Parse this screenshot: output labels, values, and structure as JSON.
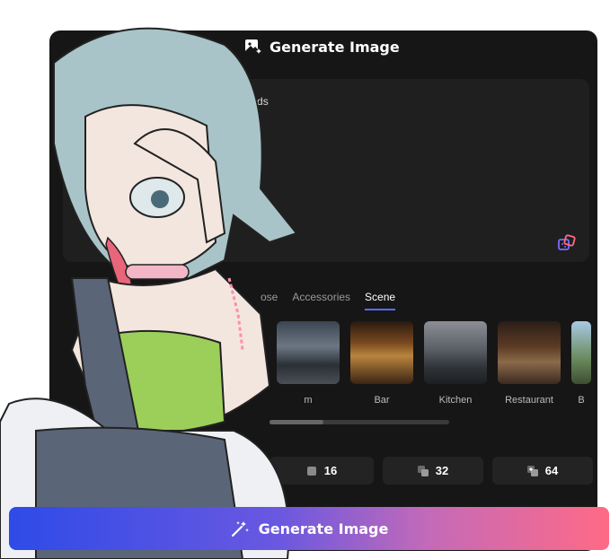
{
  "header": {
    "title": "Generate Image"
  },
  "prompt": {
    "visible_text": "iends"
  },
  "tabs": [
    {
      "label": "ose",
      "active": false
    },
    {
      "label": "Accessories",
      "active": false
    },
    {
      "label": "Scene",
      "active": true
    }
  ],
  "scenes": [
    {
      "label": "m"
    },
    {
      "label": "Bar"
    },
    {
      "label": "Kitchen"
    },
    {
      "label": "Restaurant"
    },
    {
      "label": "B"
    }
  ],
  "counts": [
    {
      "value": "16"
    },
    {
      "value": "32"
    },
    {
      "value": "64"
    }
  ],
  "generate_button": {
    "label": "Generate Image"
  },
  "colors": {
    "accent": "#5b6bff",
    "panel_bg": "#161616",
    "button_gradient_start": "#2e4be8",
    "button_gradient_end": "#ff6a86"
  }
}
